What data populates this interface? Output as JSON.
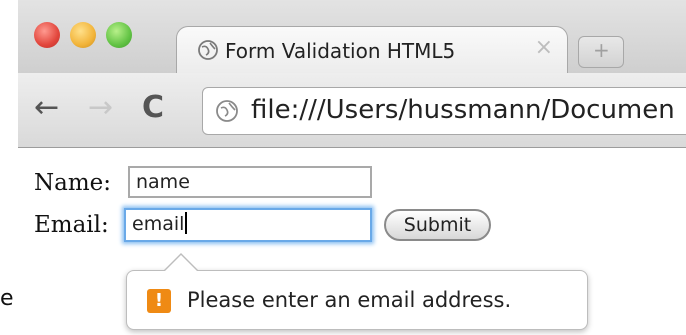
{
  "tab": {
    "title": "Form Validation HTML5",
    "close_glyph": "×",
    "favicon": "globe-icon"
  },
  "newtab": {
    "glyph": "+"
  },
  "toolbar": {
    "back_glyph": "←",
    "forward_glyph": "→",
    "reload_glyph": "C"
  },
  "address": {
    "url": "file:///Users/hussmann/Documen",
    "icon": "globe-icon"
  },
  "form": {
    "name_label": "Name:",
    "name_value": "name",
    "email_label": "Email:",
    "email_value": "email",
    "submit_label": "Submit"
  },
  "validation": {
    "message": "Please enter an email address.",
    "icon": "warning-icon",
    "icon_glyph": "!"
  },
  "stray_char": "e",
  "colors": {
    "focus_ring": "#6aa9e8",
    "warning": "#ef8a14"
  }
}
